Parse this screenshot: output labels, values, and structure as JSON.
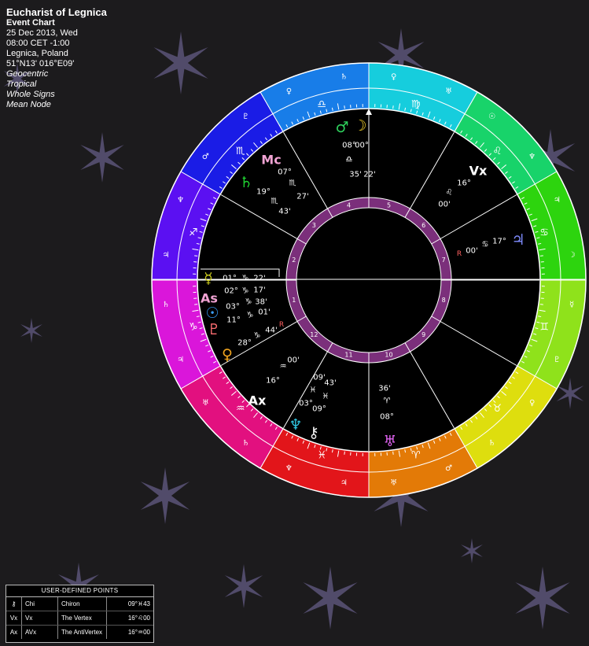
{
  "header": {
    "title": "Eucharist of Legnica",
    "chart_type": "Event Chart",
    "date": "25 Dec 2013, Wed",
    "time": "08:00  CET -1:00",
    "place": "Legnica, Poland",
    "coords": "51°N13' 016°E09'",
    "mode1": "Geocentric",
    "mode2": "Tropical",
    "mode3": "Whole Signs",
    "mode4": "Mean Node"
  },
  "wheel": {
    "signs": [
      {
        "glyph": "♐",
        "color": "#5b10f2"
      },
      {
        "glyph": "♏",
        "color": "#1a1ce6"
      },
      {
        "glyph": "♎",
        "color": "#187de8"
      },
      {
        "glyph": "♍",
        "color": "#16cddd"
      },
      {
        "glyph": "♌",
        "color": "#18d36a"
      },
      {
        "glyph": "♋",
        "color": "#2dd40e"
      },
      {
        "glyph": "♊",
        "color": "#8fe21b"
      },
      {
        "glyph": "♉",
        "color": "#dede0e"
      },
      {
        "glyph": "♈",
        "color": "#e37a07"
      },
      {
        "glyph": "♓",
        "color": "#e2151a"
      },
      {
        "glyph": "♒",
        "color": "#e2107f"
      },
      {
        "glyph": "♑",
        "color": "#da16da"
      }
    ],
    "houses": [
      "1",
      "2",
      "3",
      "4",
      "5",
      "6",
      "7",
      "8",
      "9",
      "10",
      "11",
      "12"
    ],
    "rulers": [
      [
        "♃",
        "♆"
      ],
      [
        "♂",
        "♇"
      ],
      [
        "♀",
        "♄"
      ],
      [
        "♀",
        "♅"
      ],
      [
        "☉",
        "♆"
      ],
      [
        "♃",
        "☽"
      ],
      [
        "☿",
        "♇"
      ],
      [
        "♀",
        "♄"
      ],
      [
        "♂",
        "♅"
      ],
      [
        "♃",
        "♆"
      ],
      [
        "♄",
        "♅"
      ],
      [
        "♃",
        "♄"
      ]
    ]
  },
  "points": [
    {
      "name": "Mc",
      "glyph": "Mc",
      "color": "#f1a3d3",
      "deg": "07°",
      "sign": "♏",
      "min": "27'",
      "retro": ""
    },
    {
      "name": "Saturn",
      "glyph": "♄",
      "color": "#1fd131",
      "deg": "19°",
      "sign": "♏",
      "min": "43'",
      "retro": ""
    },
    {
      "name": "Mars",
      "glyph": "♂",
      "color": "#2ed05c",
      "deg": "08°",
      "sign": "♎",
      "min": "35'",
      "retro": ""
    },
    {
      "name": "Moon",
      "glyph": "☽",
      "color": "#f4d12a",
      "deg": "00°",
      "sign": "♎",
      "min": "22'",
      "retro": ""
    },
    {
      "name": "Vertex",
      "glyph": "Vx",
      "color": "#ffffff",
      "deg": "16°",
      "sign": "♌",
      "min": "00'",
      "retro": ""
    },
    {
      "name": "Jupiter",
      "glyph": "♃",
      "color": "#7f8cff",
      "deg": "17°",
      "sign": "♋",
      "min": "00'",
      "retro": "R"
    },
    {
      "name": "Mercury",
      "glyph": "☿",
      "color": "#c9c91c",
      "deg": "01°",
      "sign": "♑",
      "min": "22'",
      "retro": ""
    },
    {
      "name": "Ascendant",
      "glyph": "As",
      "color": "#f1a3d3",
      "deg": "02°",
      "sign": "♑",
      "min": "17'",
      "retro": ""
    },
    {
      "name": "Sun",
      "glyph": "☉",
      "color": "#3aa0ff",
      "deg": "03°",
      "sign": "♑",
      "min": "38'",
      "retro": ""
    },
    {
      "name": "Pluto",
      "glyph": "♇",
      "color": "#ff6f73",
      "deg": "11°",
      "sign": "♑",
      "min": "01'",
      "retro": ""
    },
    {
      "name": "Venus",
      "glyph": "♀",
      "color": "#f0a41f",
      "deg": "28°",
      "sign": "♑",
      "min": "44'",
      "retro": "R"
    },
    {
      "name": "AntiVertex",
      "glyph": "Ax",
      "color": "#ffffff",
      "deg": "16°",
      "sign": "♒",
      "min": "00'",
      "retro": ""
    },
    {
      "name": "Neptune",
      "glyph": "♆",
      "color": "#2fc5e1",
      "deg": "03°",
      "sign": "♓",
      "min": "09'",
      "retro": ""
    },
    {
      "name": "Chiron",
      "glyph": "⚷",
      "color": "#eeeeee",
      "deg": "09°",
      "sign": "♓",
      "min": "43'",
      "retro": ""
    },
    {
      "name": "Uranus",
      "glyph": "♅",
      "color": "#e063f0",
      "deg": "08°",
      "sign": "♈",
      "min": "36'",
      "retro": ""
    }
  ],
  "user_points": {
    "title": "USER-DEFINED POINTS",
    "rows": [
      {
        "glyph": "⚷",
        "abbr": "Chi",
        "name": "Chiron",
        "pos": "09°♓43"
      },
      {
        "glyph": "Vx",
        "abbr": "Vx",
        "name": "The Vertex",
        "pos": "16°♌00"
      },
      {
        "glyph": "Ax",
        "abbr": "AVx",
        "name": "The AntiVertex",
        "pos": "16°♒00"
      }
    ]
  }
}
